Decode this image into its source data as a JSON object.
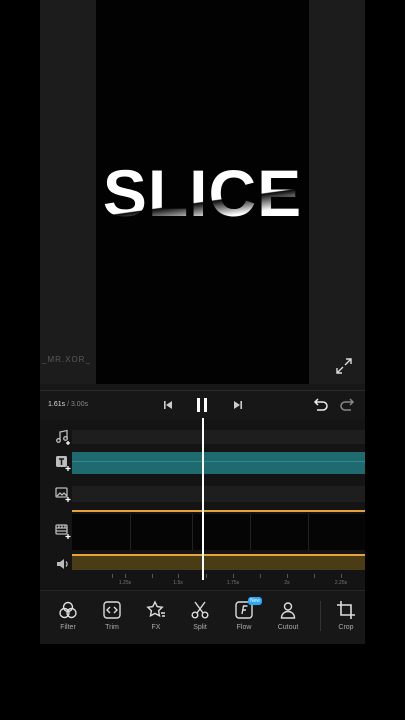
{
  "preview": {
    "title_text": "SLICE",
    "watermark": "_MR.XOR_"
  },
  "playback": {
    "current_time": "1.61s",
    "separator": " / ",
    "total_time": "3.00s",
    "state": "playing"
  },
  "ruler": {
    "labels": [
      "1.25s",
      "1.5s",
      "1.75s",
      "2s",
      "2.25s"
    ]
  },
  "toolbar": {
    "tools": [
      {
        "label": "Filter",
        "icon": "filter-icon"
      },
      {
        "label": "Trim",
        "icon": "trim-icon"
      },
      {
        "label": "FX",
        "icon": "fx-star-icon"
      },
      {
        "label": "Split",
        "icon": "scissors-icon"
      },
      {
        "label": "Flow",
        "icon": "flow-icon"
      },
      {
        "label": "Cutout",
        "icon": "cutout-person-icon"
      },
      {
        "label": "Crop",
        "icon": "crop-icon"
      }
    ],
    "new_badge": "New"
  },
  "colors": {
    "text_track": "#1f6a6e",
    "audio_track": "#4a3c14",
    "accent_orange": "#e8a23a",
    "badge_blue": "#2aa7ff"
  }
}
